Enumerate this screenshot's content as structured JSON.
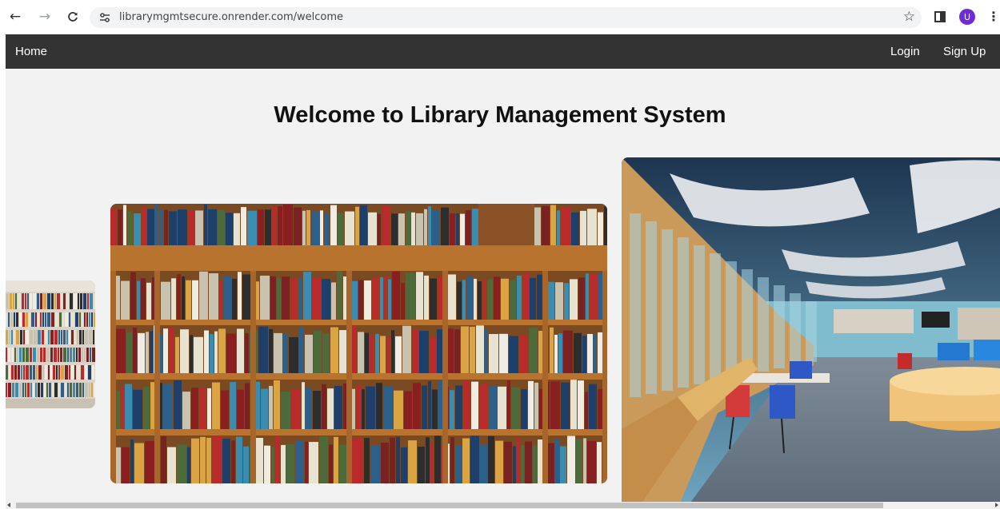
{
  "browser": {
    "back_icon": "←",
    "forward_icon": "→",
    "reload_icon": "C",
    "url": "librarymgmtsecure.onrender.com/welcome",
    "star_icon": "☆",
    "avatar_letter": "U",
    "menu_icon": "⋮"
  },
  "nav": {
    "home": "Home",
    "login": "Login",
    "signup": "Sign Up"
  },
  "page": {
    "title": "Welcome to Library Management System"
  },
  "carousel": {
    "images": [
      "library-shelves-thumbnail",
      "bookshelf-photo",
      "library-interior-photo"
    ]
  },
  "colors": {
    "navbar": "#333333",
    "page_bg": "#f2f2f2",
    "avatar": "#6f2bd6"
  }
}
